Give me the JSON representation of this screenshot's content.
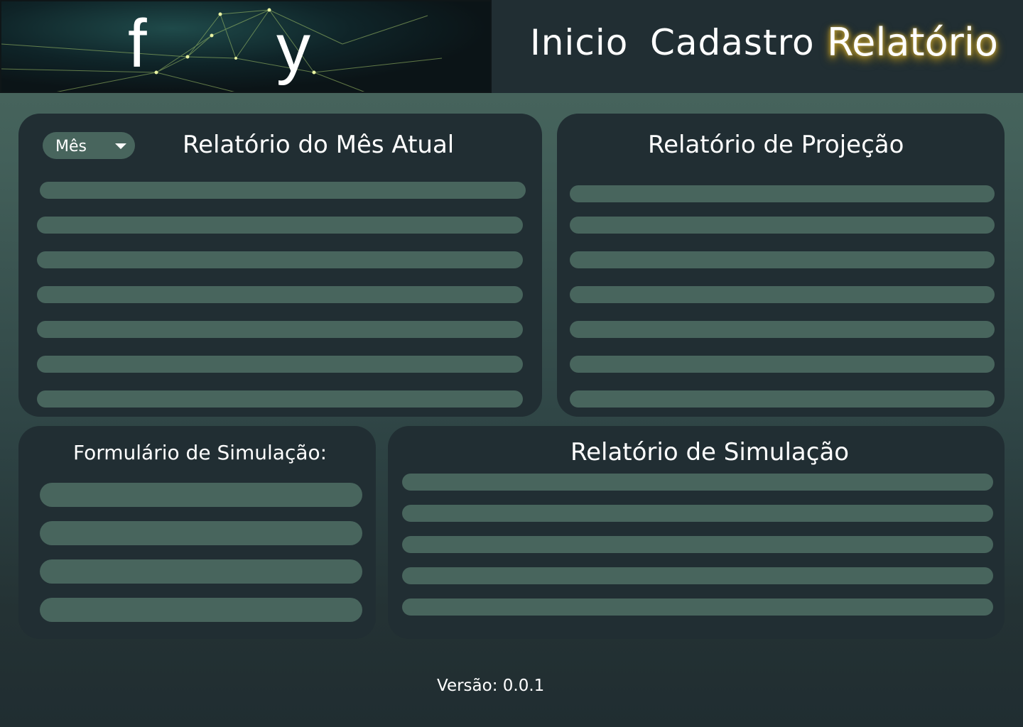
{
  "header": {
    "logo": {
      "letter_left": "f",
      "letter_right": "y"
    },
    "nav": [
      {
        "label": "Inicio",
        "active": false
      },
      {
        "label": "Cadastro",
        "active": false
      },
      {
        "label": "Relatório",
        "active": true
      }
    ]
  },
  "panels": {
    "current_month": {
      "title": "Relatório do Mês Atual",
      "month_select": {
        "selected": "Mês",
        "icon": "chevron-down-icon"
      },
      "row_count": 7
    },
    "projection": {
      "title": "Relatório de Projeção",
      "row_count": 7
    },
    "simulation_form": {
      "title": "Formulário de Simulação:",
      "field_count": 4
    },
    "simulation_report": {
      "title": "Relatório de Simulação",
      "row_count": 5
    }
  },
  "footer": {
    "version": "Versão: 0.0.1"
  },
  "colors": {
    "panel": "#212e33",
    "placeholder": "#48655d",
    "active_nav_glow": "#c9a93a"
  }
}
